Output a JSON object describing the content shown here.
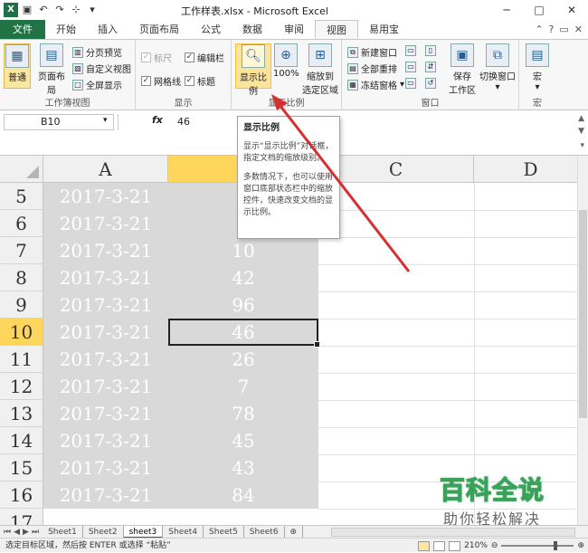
{
  "window": {
    "title": "工作样表.xlsx - Microsoft Excel",
    "controls": [
      "─",
      "□",
      "✕"
    ]
  },
  "ribbon_tabs": {
    "file": "文件",
    "items": [
      "开始",
      "插入",
      "页面布局",
      "公式",
      "数据",
      "审阅",
      "视图",
      "易用宝"
    ],
    "active": "视图"
  },
  "groups": {
    "workbook_views": {
      "label": "工作簿视图",
      "normal": "普通",
      "page_layout": "页面布局",
      "page_break": "分页预览",
      "custom_views": "自定义视图",
      "full_screen": "全屏显示"
    },
    "show": {
      "label": "显示",
      "ruler": "标尺",
      "formula_bar": "编辑栏",
      "gridlines": "网格线",
      "headings": "标题"
    },
    "zoom": {
      "label": "显示比例",
      "zoom": "显示比例",
      "hundred": "100%",
      "zoom_to_selection_1": "缩放到",
      "zoom_to_selection_2": "选定区域"
    },
    "window": {
      "label": "窗口",
      "new_window": "新建窗口",
      "arrange_all": "全部重排",
      "freeze": "冻结窗格",
      "save_workspace_1": "保存",
      "save_workspace_2": "工作区",
      "switch_windows": "切换窗口"
    },
    "macros": {
      "label": "宏",
      "macro": "宏"
    }
  },
  "formula_bar": {
    "name_box": "B10",
    "fx": "fx",
    "value": "46"
  },
  "tooltip": {
    "title": "显示比例",
    "line1": "显示“显示比例”对话框，指定文档的缩放级别。",
    "line2": "多数情况下，也可以使用窗口底部状态栏中的缩放控件，快速改变文档的显示比例。"
  },
  "columns": [
    "A",
    "B",
    "C",
    "D"
  ],
  "rows": [
    {
      "num": "5",
      "a": "2017-3-21",
      "b": "3"
    },
    {
      "num": "6",
      "a": "2017-3-21",
      "b": "3"
    },
    {
      "num": "7",
      "a": "2017-3-21",
      "b": "10"
    },
    {
      "num": "8",
      "a": "2017-3-21",
      "b": "42"
    },
    {
      "num": "9",
      "a": "2017-3-21",
      "b": "96"
    },
    {
      "num": "10",
      "a": "2017-3-21",
      "b": "46"
    },
    {
      "num": "11",
      "a": "2017-3-21",
      "b": "26"
    },
    {
      "num": "12",
      "a": "2017-3-21",
      "b": "7"
    },
    {
      "num": "13",
      "a": "2017-3-21",
      "b": "78"
    },
    {
      "num": "14",
      "a": "2017-3-21",
      "b": "45"
    },
    {
      "num": "15",
      "a": "2017-3-21",
      "b": "43"
    },
    {
      "num": "16",
      "a": "2017-3-21",
      "b": "84"
    },
    {
      "num": "17",
      "a": "",
      "b": ""
    }
  ],
  "sheets": [
    "Sheet1",
    "Sheet2",
    "sheet3",
    "Sheet4",
    "Sheet5",
    "Sheet6"
  ],
  "active_sheet": "sheet3",
  "status": {
    "message": "选定目标区域，然后按 ENTER 或选择 “粘贴”",
    "zoom": "210%"
  },
  "watermark": {
    "big": "百科全说",
    "small": "助你轻松解决"
  },
  "colors": {
    "excel_green": "#217346",
    "selection_yellow": "#ffd65c",
    "arrow_red": "#d62f2f"
  }
}
